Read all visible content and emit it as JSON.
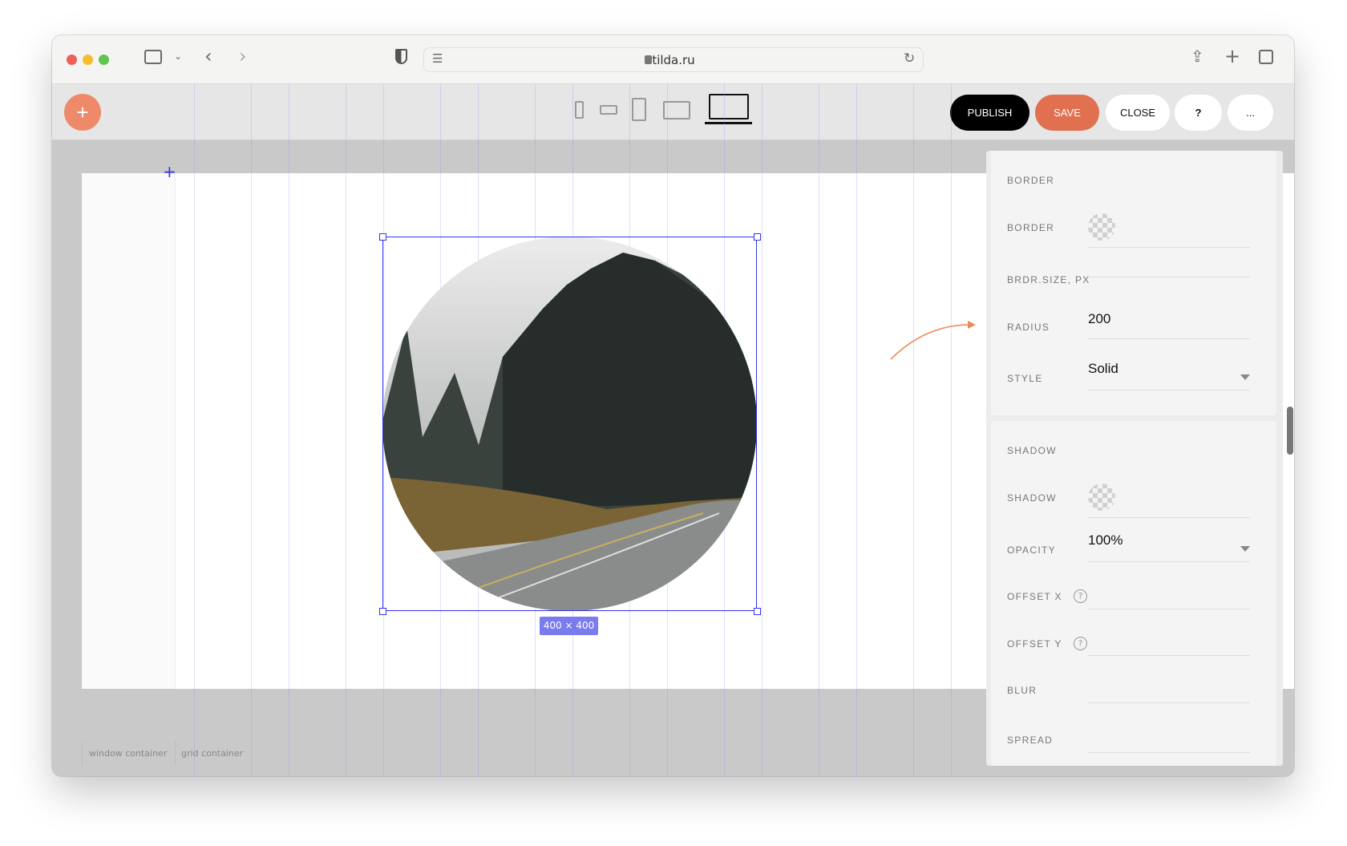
{
  "browser": {
    "url": "tilda.ru"
  },
  "toolbar": {
    "publish": "PUBLISH",
    "save": "SAVE",
    "close": "CLOSE",
    "help": "?",
    "more": "...",
    "add": "+"
  },
  "canvas": {
    "size_label": "400 × 400",
    "window_container": "window container",
    "grid_container": "grid container"
  },
  "panel": {
    "border_section": {
      "title": "BORDER",
      "border_label": "BORDER",
      "size_label": "BRDR.SIZE, PX",
      "radius_label": "RADIUS",
      "radius_value": "200",
      "style_label": "STYLE",
      "style_value": "Solid"
    },
    "shadow_section": {
      "title": "SHADOW",
      "shadow_label": "SHADOW",
      "opacity_label": "OPACITY",
      "opacity_value": "100%",
      "offset_x_label": "OFFSET X",
      "offset_y_label": "OFFSET Y",
      "blur_label": "BLUR",
      "spread_label": "SPREAD",
      "help": "?"
    }
  },
  "colors": {
    "accent": "#e8704f",
    "selection": "#3333ee",
    "publish": "#000000"
  }
}
